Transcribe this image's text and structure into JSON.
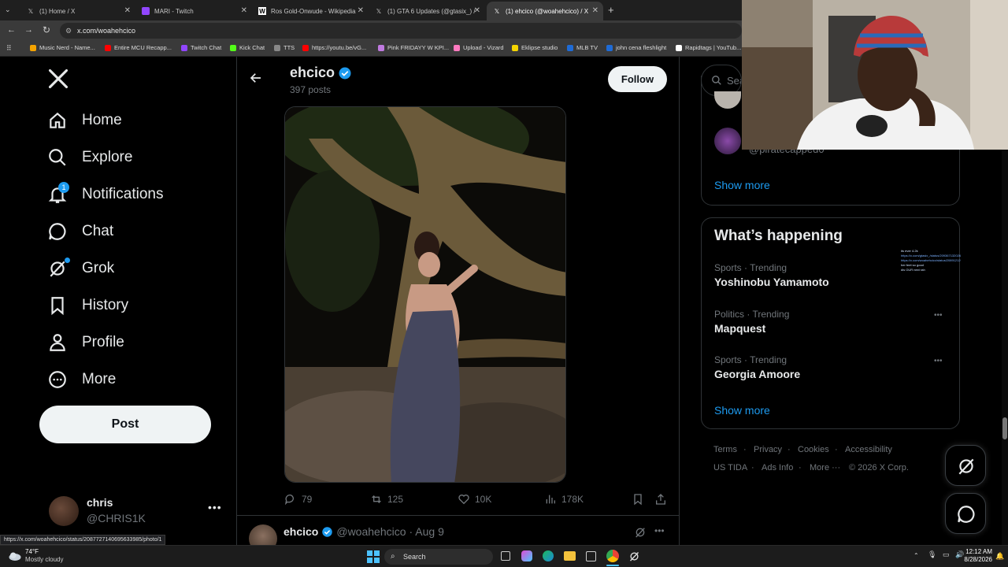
{
  "tabs": [
    {
      "title": "(1) Home / X",
      "icon": "x-icon",
      "active": false
    },
    {
      "title": "MARI - Twitch",
      "icon": "twitch-icon",
      "active": false
    },
    {
      "title": "Ros Gold-Onwude - Wikipedia",
      "icon": "wikipedia-icon",
      "active": false
    },
    {
      "title": "(1) GTA 6 Updates (@gtasix_) /",
      "icon": "x-icon",
      "active": false
    },
    {
      "title": "(1) ehcico (@woahehcico) / X",
      "icon": "x-icon",
      "active": true
    }
  ],
  "address": {
    "url": "x.com/woahehcico"
  },
  "bookmarks": [
    {
      "label": "Music Nerd - Name...",
      "color": "#f4a300"
    },
    {
      "label": "Entire MCU Recapp...",
      "color": "#ff0000"
    },
    {
      "label": "Twitch Chat",
      "color": "#9146ff"
    },
    {
      "label": "Kick Chat",
      "color": "#53fc18"
    },
    {
      "label": "TTS",
      "color": "#888888"
    },
    {
      "label": "https://youtu.be/vG...",
      "color": "#ff0000"
    },
    {
      "label": "Pink FRIDAYY W KPI...",
      "color": "#c07ae0"
    },
    {
      "label": "Upload - Vizard",
      "color": "#ff7ac0"
    },
    {
      "label": "Eklipse studio",
      "color": "#f4d400"
    },
    {
      "label": "MLB TV",
      "color": "#1e6bd6"
    },
    {
      "label": "john cena fleshlight",
      "color": "#1e6bd6"
    },
    {
      "label": "Rapidtags | YouTub...",
      "color": "#ffffff"
    }
  ],
  "nav": {
    "items": [
      {
        "label": "Home",
        "icon": "home-icon"
      },
      {
        "label": "Explore",
        "icon": "search-icon"
      },
      {
        "label": "Notifications",
        "icon": "bell-icon",
        "badge": "1"
      },
      {
        "label": "Chat",
        "icon": "chat-icon"
      },
      {
        "label": "Grok",
        "icon": "grok-icon"
      },
      {
        "label": "History",
        "icon": "bookmark-icon"
      },
      {
        "label": "Profile",
        "icon": "person-icon"
      },
      {
        "label": "More",
        "icon": "more-circle-icon"
      }
    ],
    "post_label": "Post"
  },
  "account": {
    "name": "chris",
    "handle": "@CHRIS1K"
  },
  "profile_header": {
    "name": "ehcico",
    "posts": "397 posts",
    "follow_label": "Follow"
  },
  "post": {
    "replies": "79",
    "reposts": "125",
    "likes": "10K",
    "views": "178K"
  },
  "next_post": {
    "name": "ehcico",
    "handle": "@woahehcico",
    "date": "· Aug 9"
  },
  "status_url": "https://x.com/woahehcico/status/2087727140695633985/photo/1",
  "sidebar": {
    "search_placeholder": "Sea",
    "who_to_follow": {
      "partial_handle": "@piratecapped0",
      "show_more": "Show more"
    },
    "whats_happening": {
      "title": "What’s happening",
      "trends": [
        {
          "meta": "Sports · Trending",
          "name": "Yoshinobu Yamamoto"
        },
        {
          "meta": "Politics · Trending",
          "name": "Mapquest"
        },
        {
          "meta": "Sports · Trending",
          "name": "Georgia Amoore"
        }
      ],
      "show_more": "Show more"
    },
    "footer": {
      "row1": [
        "Terms",
        "Privacy",
        "Cookies",
        "Accessibility"
      ],
      "row2": [
        "US TIDA",
        "Ads Info",
        "More ···",
        "© 2026 X Corp."
      ]
    }
  },
  "chat_overlay": {
    "lines": [
      "its ever 4.2k",
      "https://x.com/gtasix_/status/20936713202631519461/s",
      "https://x.com/woahehcico/status/2089121296928174...",
      "her feet so good",
      "dis OUR next rah"
    ]
  },
  "taskbar": {
    "weather_temp": "74°F",
    "weather_desc": "Mostly cloudy",
    "search_label": "Search",
    "time": "12:12 AM",
    "date": "8/28/2026"
  }
}
